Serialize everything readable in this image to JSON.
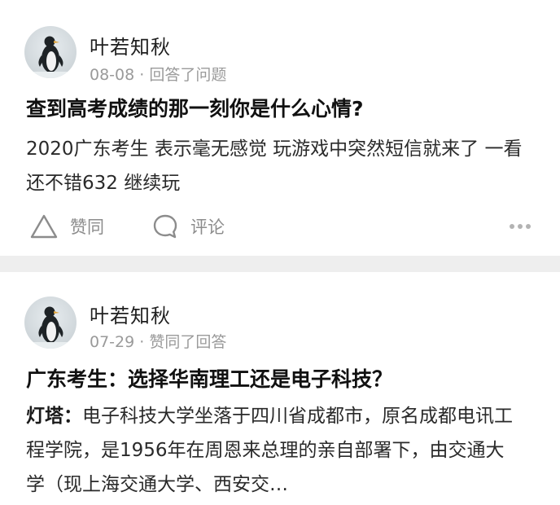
{
  "feed": [
    {
      "author": "叶若知秋",
      "meta": "08-08 · 回答了问题",
      "title": "查到高考成绩的那一刻你是什么心情?",
      "excerpt_lead": "",
      "excerpt": "2020广东考生 表示毫无感觉 玩游戏中突然短信就来了 一看还不错632 继续玩",
      "actions": {
        "like_label": "赞同",
        "comment_label": "评论"
      }
    },
    {
      "author": "叶若知秋",
      "meta": "07-29 · 赞同了回答",
      "title": "广东考生：选择华南理工还是电子科技？",
      "excerpt_lead": "灯塔：",
      "excerpt": "电子科技大学坐落于四川省成都市，原名成都电讯工程学院，是1956年在周恩来总理的亲自部署下，由交通大学（现上海交通大学、西安交…"
    }
  ],
  "icons": {
    "like": "triangle-like-icon",
    "comment": "speech-bubble-icon",
    "more": "more-dots-icon"
  }
}
